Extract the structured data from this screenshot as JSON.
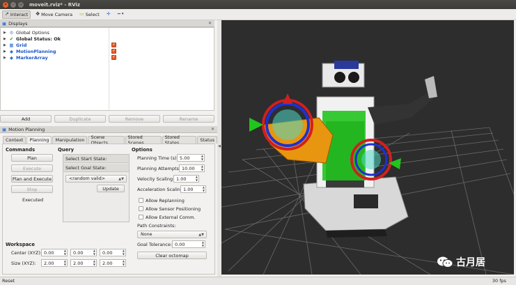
{
  "window": {
    "title": "moveit.rviz* - RViz"
  },
  "toolbar": {
    "interact": "Interact",
    "move_camera": "Move Camera",
    "select": "Select"
  },
  "displays": {
    "header": "Displays",
    "items": [
      {
        "label": "Global Options",
        "style": "normal",
        "checked": false
      },
      {
        "label": "Global Status: Ok",
        "style": "bold",
        "checked": false
      },
      {
        "label": "Grid",
        "style": "blue",
        "checked": true
      },
      {
        "label": "MotionPlanning",
        "style": "blue",
        "checked": true
      },
      {
        "label": "MarkerArray",
        "style": "blue",
        "checked": true
      }
    ],
    "buttons": {
      "add": "Add",
      "duplicate": "Duplicate",
      "remove": "Remove",
      "rename": "Rename"
    }
  },
  "motion_planning": {
    "header": "Motion Planning",
    "tabs": [
      "Context",
      "Planning",
      "Manipulation",
      "Scene Objects",
      "Stored Scenes",
      "Stored States",
      "Status"
    ],
    "active_tab": "Planning",
    "commands": {
      "title": "Commands",
      "plan": "Plan",
      "execute": "Execute",
      "plan_and_execute": "Plan and Execute",
      "stop": "Stop",
      "status": "Executed"
    },
    "query": {
      "title": "Query",
      "start_state": "Select Start State:",
      "goal_state": "Select Goal State:",
      "goal_value": "<random valid>",
      "update": "Update"
    },
    "options": {
      "title": "Options",
      "planning_time_label": "Planning Time (s):",
      "planning_time": "5.00",
      "planning_attempts_label": "Planning Attempts:",
      "planning_attempts": "10.00",
      "velocity_scaling_label": "Velocity Scaling:",
      "velocity_scaling": "1.00",
      "acceleration_scaling_label": "Acceleration Scaling:",
      "acceleration_scaling": "1.00",
      "allow_replanning": "Allow Replanning",
      "allow_sensor_positioning": "Allow Sensor Positioning",
      "allow_external_comm": "Allow External Comm.",
      "path_constraints_label": "Path Constraints:",
      "path_constraints": "None",
      "goal_tolerance_label": "Goal Tolerance:",
      "goal_tolerance": "0.00",
      "clear_octomap": "Clear octomap"
    },
    "workspace": {
      "title": "Workspace",
      "center_label": "Center (XYZ):",
      "center": [
        "0.00",
        "0.00",
        "0.00"
      ],
      "size_label": "Size (XYZ):",
      "size": [
        "2.00",
        "2.00",
        "2.00"
      ]
    }
  },
  "status_bar": {
    "reset": "Reset",
    "fps": "30 fps"
  },
  "watermark": {
    "text": "古月居"
  },
  "colors": {
    "viewport_bg": "#2d2d2d",
    "checkbox_orange": "#e35b2a",
    "link_blue": "#1a55c8",
    "robot_green": "#22c41f",
    "robot_orange": "#e8960f"
  }
}
